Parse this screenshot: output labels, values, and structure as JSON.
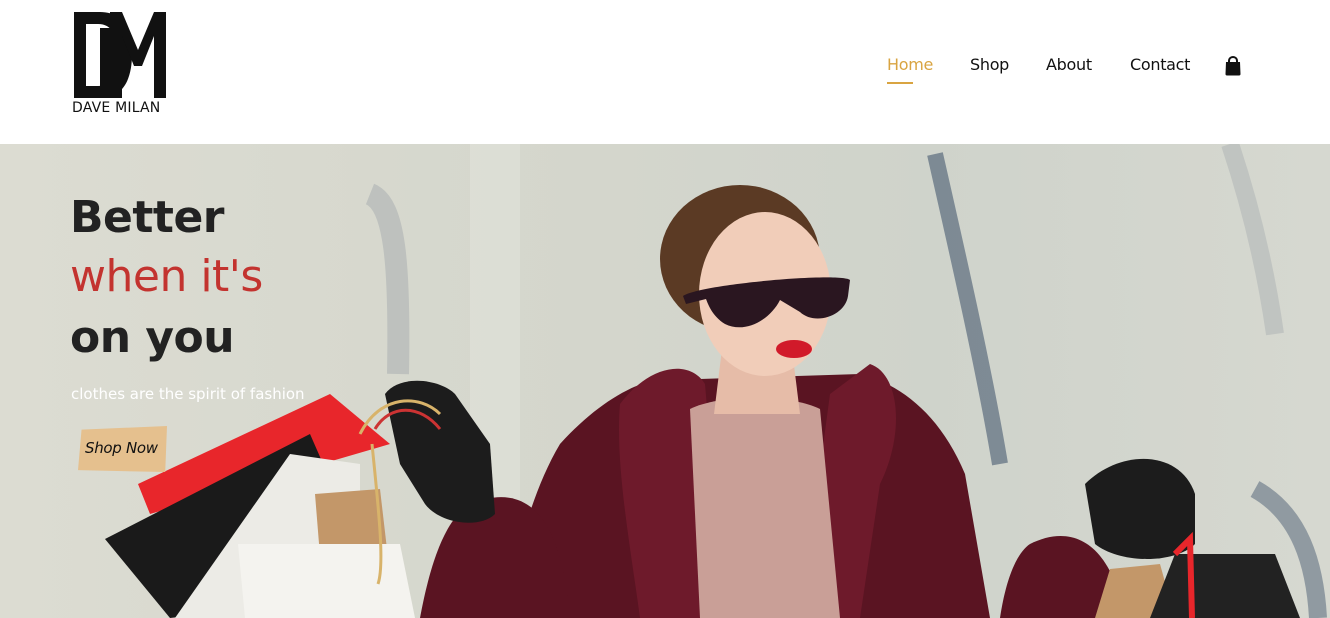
{
  "brand": {
    "logo_text": "DAVE MILAN"
  },
  "nav": {
    "items": [
      {
        "label": "Home",
        "active": true
      },
      {
        "label": "Shop",
        "active": false
      },
      {
        "label": "About",
        "active": false
      },
      {
        "label": "Contact",
        "active": false
      }
    ],
    "cart_icon": "shopping-bag-icon",
    "accent_color": "#d9a441"
  },
  "hero": {
    "headline_line1": "Better",
    "headline_line2": "when it's",
    "headline_line3": "on you",
    "headline_accent_color": "#c3332f",
    "tagline": "clothes are the spirit of fashion",
    "cta_label": "Shop Now",
    "cta_color": "#e5c08e"
  }
}
